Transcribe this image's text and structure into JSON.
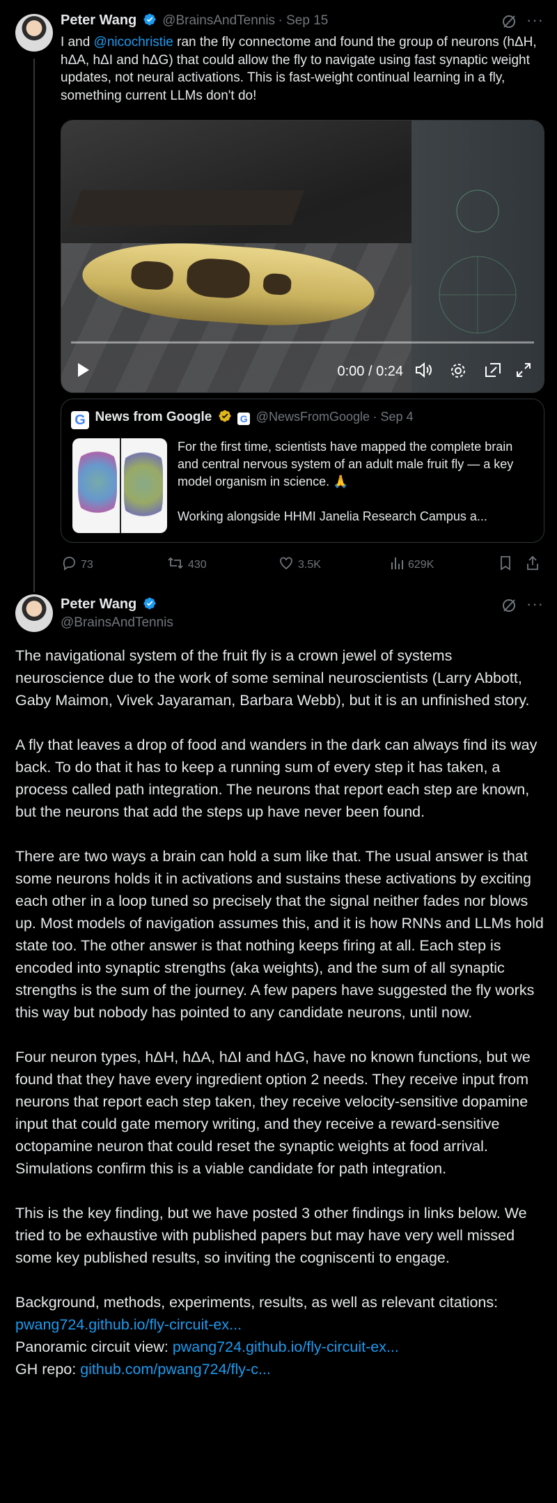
{
  "post1": {
    "author_name": "Peter Wang",
    "handle": "@BrainsAndTennis",
    "date": "Sep 15",
    "text_pre": "I and ",
    "mention": "@nicochristie",
    "text_post": " ran the fly connectome and found the group of neurons (hΔH, hΔA, hΔI and hΔG) that could allow the fly to navigate using fast synaptic weight updates, not neural activations. This is fast-weight continual learning in a fly, something current LLMs don't do!",
    "video": {
      "time": "0:00 / 0:24",
      "progress": 0
    },
    "quote": {
      "author_name": "News from Google",
      "handle": "@NewsFromGoogle",
      "date": "Sep 4",
      "line1": "For the first time, scientists have mapped the complete brain and central nervous system of an adult male fruit fly — a key model organism in science. 🙏",
      "line2": "Working alongside HHMI Janelia Research Campus a..."
    },
    "actions": {
      "replies": "73",
      "reposts": "430",
      "likes": "3.5K",
      "views": "629K"
    }
  },
  "post2": {
    "author_name": "Peter Wang",
    "handle": "@BrainsAndTennis",
    "paragraphs": [
      "The navigational system of the fruit fly is a crown jewel of systems neuroscience due to the work of some seminal neuroscientists (Larry Abbott, Gaby Maimon, Vivek Jayaraman, Barbara Webb), but it is an unfinished story.",
      "A fly that leaves a drop of food and wanders in the dark can always find its way back. To do that it has to keep a running sum of every step it has taken, a process called path integration. The neurons that report each step are known, but the neurons that add the steps up have never been found.",
      "There are two ways a brain can hold a sum like that. The usual answer is that some neurons holds it in activations and sustains these activations by exciting each other in a loop tuned so precisely that the signal neither fades nor blows up. Most models of navigation assumes this, and it is how RNNs and LLMs hold state too. The other answer is that nothing keeps firing at all. Each step is encoded into synaptic strengths (aka weights), and the sum of all synaptic strengths is the sum of the journey. A few papers have suggested the fly works this way but nobody has pointed to any candidate neurons, until now.",
      "Four neuron types, hΔH, hΔA, hΔI and hΔG, have no known functions, but we found that they have every ingredient option 2 needs. They receive input from neurons that report each step taken, they receive velocity-sensitive dopamine input that could gate memory writing, and they receive a reward-sensitive octopamine neuron that could reset the synaptic weights at food arrival. Simulations confirm this is a viable candidate for path integration.",
      "This is the key finding, but we have posted 3 other findings in links below. We tried to be exhaustive with published papers but may have very well missed some key published results, so inviting the cogniscenti to engage."
    ],
    "links": [
      {
        "label": "Background, methods, experiments, results, as well as relevant citations: ",
        "url": "pwang724.github.io/fly-circuit-ex..."
      },
      {
        "label": "Panoramic circuit view: ",
        "url": "pwang724.github.io/fly-circuit-ex..."
      },
      {
        "label": "GH repo: ",
        "url": "github.com/pwang724/fly-c..."
      }
    ]
  },
  "icons": {
    "verified": "verified-badge-icon",
    "grok": "grok-icon",
    "more": "more-icon"
  },
  "colors": {
    "accent": "#1d9bf0",
    "gold": "#e2b719",
    "muted": "#71767b",
    "bg": "#000000"
  }
}
